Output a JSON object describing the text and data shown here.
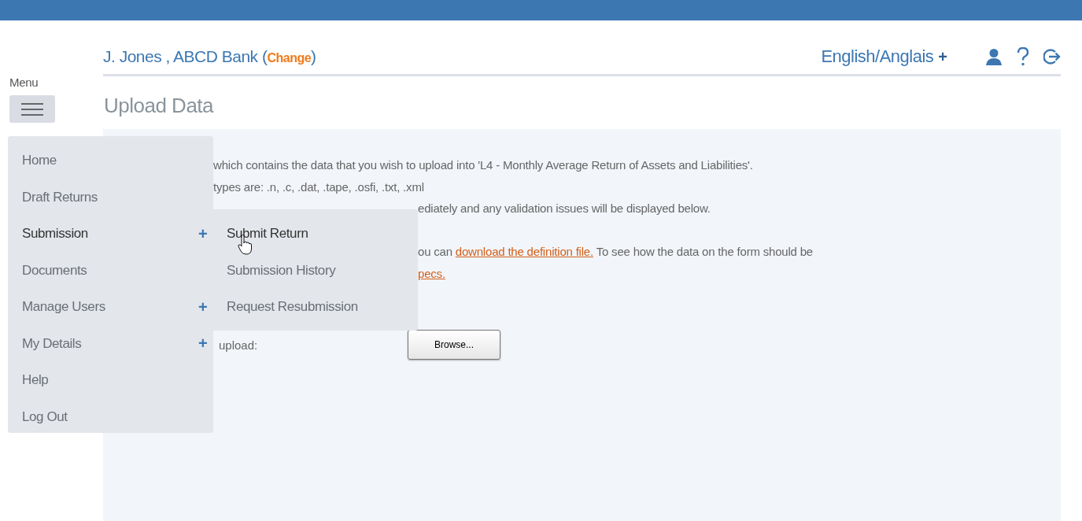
{
  "header": {
    "account": [
      {
        "kind": "text",
        "text": "J. Jones , ABCD Bank ("
      },
      {
        "kind": "link",
        "text": "Change"
      },
      {
        "kind": "text",
        "text": ")"
      }
    ],
    "language": "English/Anglais",
    "language_expand": "+"
  },
  "menu": {
    "label": "Menu",
    "items": [
      {
        "label": "Home",
        "expanded": false
      },
      {
        "label": "Draft Returns",
        "expanded": false
      },
      {
        "label": "Submission",
        "expand": "+",
        "expanded": true,
        "children": [
          {
            "label": "Submit Return",
            "selected": true
          },
          {
            "label": "Submission History",
            "selected": false
          },
          {
            "label": "Request Resubmission",
            "selected": false
          }
        ]
      },
      {
        "label": "Documents",
        "expanded": false
      },
      {
        "label": "Manage Users",
        "expand": "+",
        "expanded": false
      },
      {
        "label": "My Details",
        "expand": "+",
        "expanded": false
      },
      {
        "label": "Help",
        "expanded": false
      },
      {
        "label": "Log Out",
        "expanded": false
      }
    ]
  },
  "page_title": "Upload Data",
  "content": {
    "paragraphs": [
      [
        [
          {
            "kind": "text",
            "text": "which contains the data that you wish to upload into 'L4 - Monthly Average Return of Assets and Liabilities'."
          }
        ],
        [
          {
            "kind": "text",
            "text": "types are: .n, .c, .dat, .tape, .osfi, .txt, .xml"
          }
        ],
        [
          {
            "kind": "text",
            "text": "ediately and any validation issues will be displayed below."
          }
        ]
      ],
      [
        [
          {
            "kind": "text",
            "text": "ou can "
          },
          {
            "kind": "link",
            "text": "download the definition file."
          },
          {
            "kind": "text",
            "text": " To see how the data on the form should be"
          }
        ],
        [
          {
            "kind": "link",
            "text": "pecs."
          }
        ]
      ]
    ],
    "upload_label": "upload:",
    "browse_button": "Browse..."
  }
}
